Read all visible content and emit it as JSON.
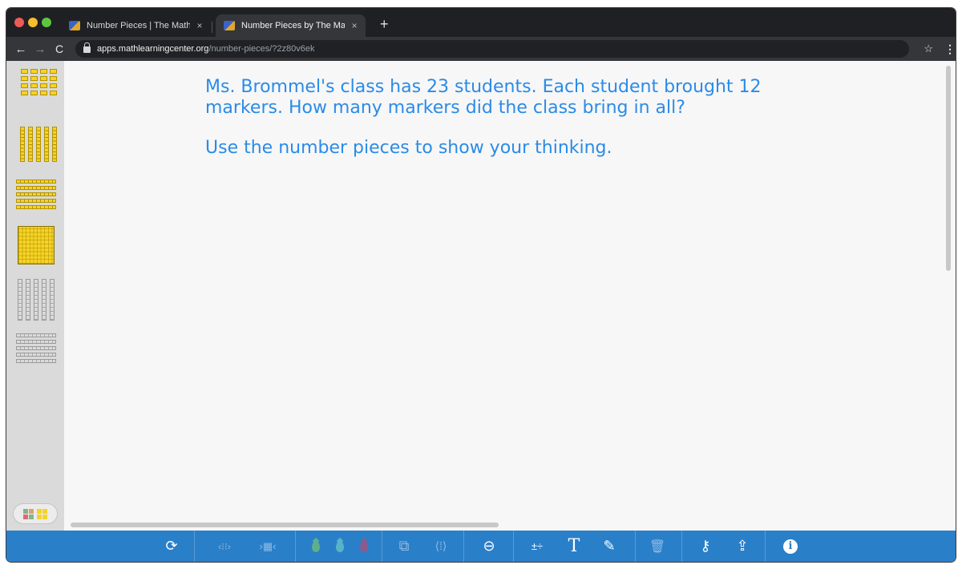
{
  "browser": {
    "tabs": [
      {
        "title": "Number Pieces | The Math Lea",
        "active": false
      },
      {
        "title": "Number Pieces by The Math Le",
        "active": true
      }
    ],
    "tab_close_glyph": "×",
    "new_tab_glyph": "+",
    "url_domain": "apps.mathlearningcenter.org",
    "url_path": "/number-pieces/?2z80v6ek"
  },
  "problem": {
    "line1": "Ms. Brommel's class has 23 students. Each student brought 12 markers. How many markers did the class bring in all?",
    "line2": "Use the number pieces to show your thinking."
  },
  "colors": {
    "accent_blue": "#2a8be8",
    "toolbar_blue": "#2a7fc9",
    "piece_yellow": "#f6d327",
    "drop_green": "#5fae8c",
    "drop_teal": "#59b3c9",
    "drop_purple": "#8a5b8c"
  },
  "toolbar": {
    "items": [
      {
        "name": "refresh-icon",
        "glyph": "⟳"
      },
      {
        "name": "break-apart-icon",
        "glyph": "‹⁝⁝›"
      },
      {
        "name": "group-icon",
        "glyph": "›▦‹"
      },
      {
        "name": "green-drop-icon",
        "glyph": ""
      },
      {
        "name": "teal-drop-icon",
        "glyph": ""
      },
      {
        "name": "purple-drop-icon",
        "glyph": ""
      },
      {
        "name": "duplicate-icon",
        "glyph": "⧉"
      },
      {
        "name": "rotate-icon",
        "glyph": "⟨⁞⟩"
      },
      {
        "name": "zoom-out-icon",
        "glyph": "⊖"
      },
      {
        "name": "operations-icon",
        "glyph": "±÷"
      },
      {
        "name": "text-icon",
        "glyph": "T"
      },
      {
        "name": "pencil-icon",
        "glyph": "✎"
      },
      {
        "name": "trash-icon",
        "glyph": "🗑"
      },
      {
        "name": "key-icon",
        "glyph": "⚷"
      },
      {
        "name": "share-icon",
        "glyph": "⇪"
      },
      {
        "name": "info-icon",
        "glyph": "i"
      }
    ]
  }
}
